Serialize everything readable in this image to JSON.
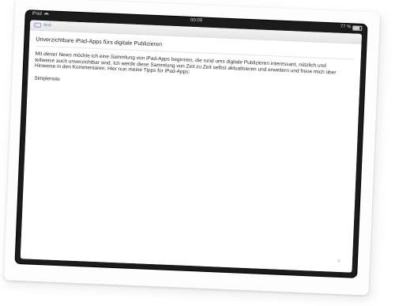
{
  "statusbar": {
    "carrier": "iPad",
    "time": "00:09",
    "battery_text": "77 %",
    "battery_level": 0.77
  },
  "toolbar": {
    "link_label": "text"
  },
  "note": {
    "title": "Unverzichtbare iPad-Apps fürs digitale Publizieren",
    "body": "Mit dieser News möchte ich eine Sammlung von iPad-Apps beginnen, die rund ums digitale Publizieren interessant, nützlich und teilweise auch unverzichtbar sind. Ich werde diese Sammlung von Zeit zu Zeit selbst aktualisieren und erweitern und freue mich über Hinweise in den Kommentaren. Hier nun meine Tipps für iPad-Apps:",
    "section": "Simplenote"
  },
  "icons": {
    "tag": "tag-icon",
    "close": "close-icon",
    "wifi": "wifi-icon",
    "battery": "battery-icon"
  }
}
